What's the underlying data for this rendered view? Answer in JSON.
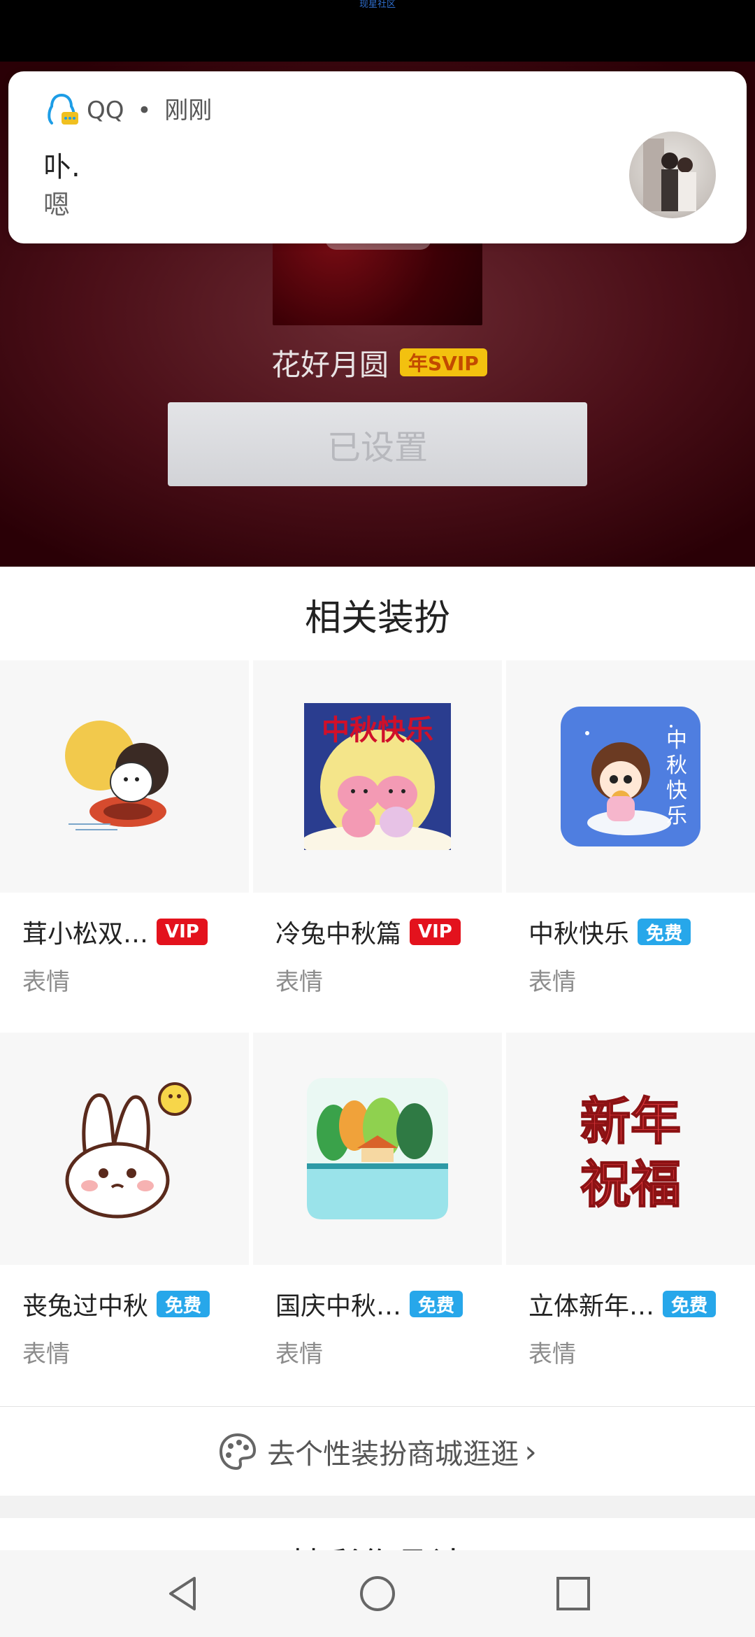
{
  "status_bar": {
    "tiny_text": "现星社区"
  },
  "notification": {
    "app": "QQ",
    "separator": "•",
    "time": "刚刚",
    "title": "卟.",
    "body": "嗯",
    "icon": "qq-penguin-icon",
    "avatar": "contact-avatar"
  },
  "theme": {
    "name": "花好月圆",
    "badge": "年SVIP",
    "button_label": "已设置"
  },
  "related": {
    "title": "相关装扮",
    "items": [
      {
        "title": "茸小松双…",
        "badge": "VIP",
        "badge_type": "vip",
        "type": "表情",
        "art": "moon-rabbit-sticker"
      },
      {
        "title": "冷兔中秋篇",
        "badge": "VIP",
        "badge_type": "vip",
        "type": "表情",
        "art": "mid-autumn-rabbits-sticker"
      },
      {
        "title": "中秋快乐",
        "badge": "免费",
        "badge_type": "free",
        "type": "表情",
        "art": "mid-autumn-girl-sticker",
        "art_text": [
          "中",
          "秋",
          "快",
          "乐"
        ]
      },
      {
        "title": "丧兔过中秋",
        "badge": "免费",
        "badge_type": "free",
        "type": "表情",
        "art": "sad-rabbit-sticker"
      },
      {
        "title": "国庆中秋…",
        "badge": "免费",
        "badge_type": "free",
        "type": "表情",
        "art": "landscape-sticker"
      },
      {
        "title": "立体新年…",
        "badge": "免费",
        "badge_type": "free",
        "type": "表情",
        "art": "new-year-sticker",
        "art_text": [
          "新年",
          "祝福"
        ]
      }
    ],
    "art_banner_text": "中秋快乐"
  },
  "shop_link": {
    "label": "去个性装扮商城逛逛",
    "chevron": "›",
    "icon": "palette-icon"
  },
  "partial_section_title": "精彩作品计",
  "nav": {
    "back": "back-icon",
    "home": "home-icon",
    "recents": "recents-icon"
  },
  "colors": {
    "vip": "#e3121d",
    "free": "#27a7ea",
    "svip": "#f3c10f",
    "hero": "#4b0f18"
  }
}
